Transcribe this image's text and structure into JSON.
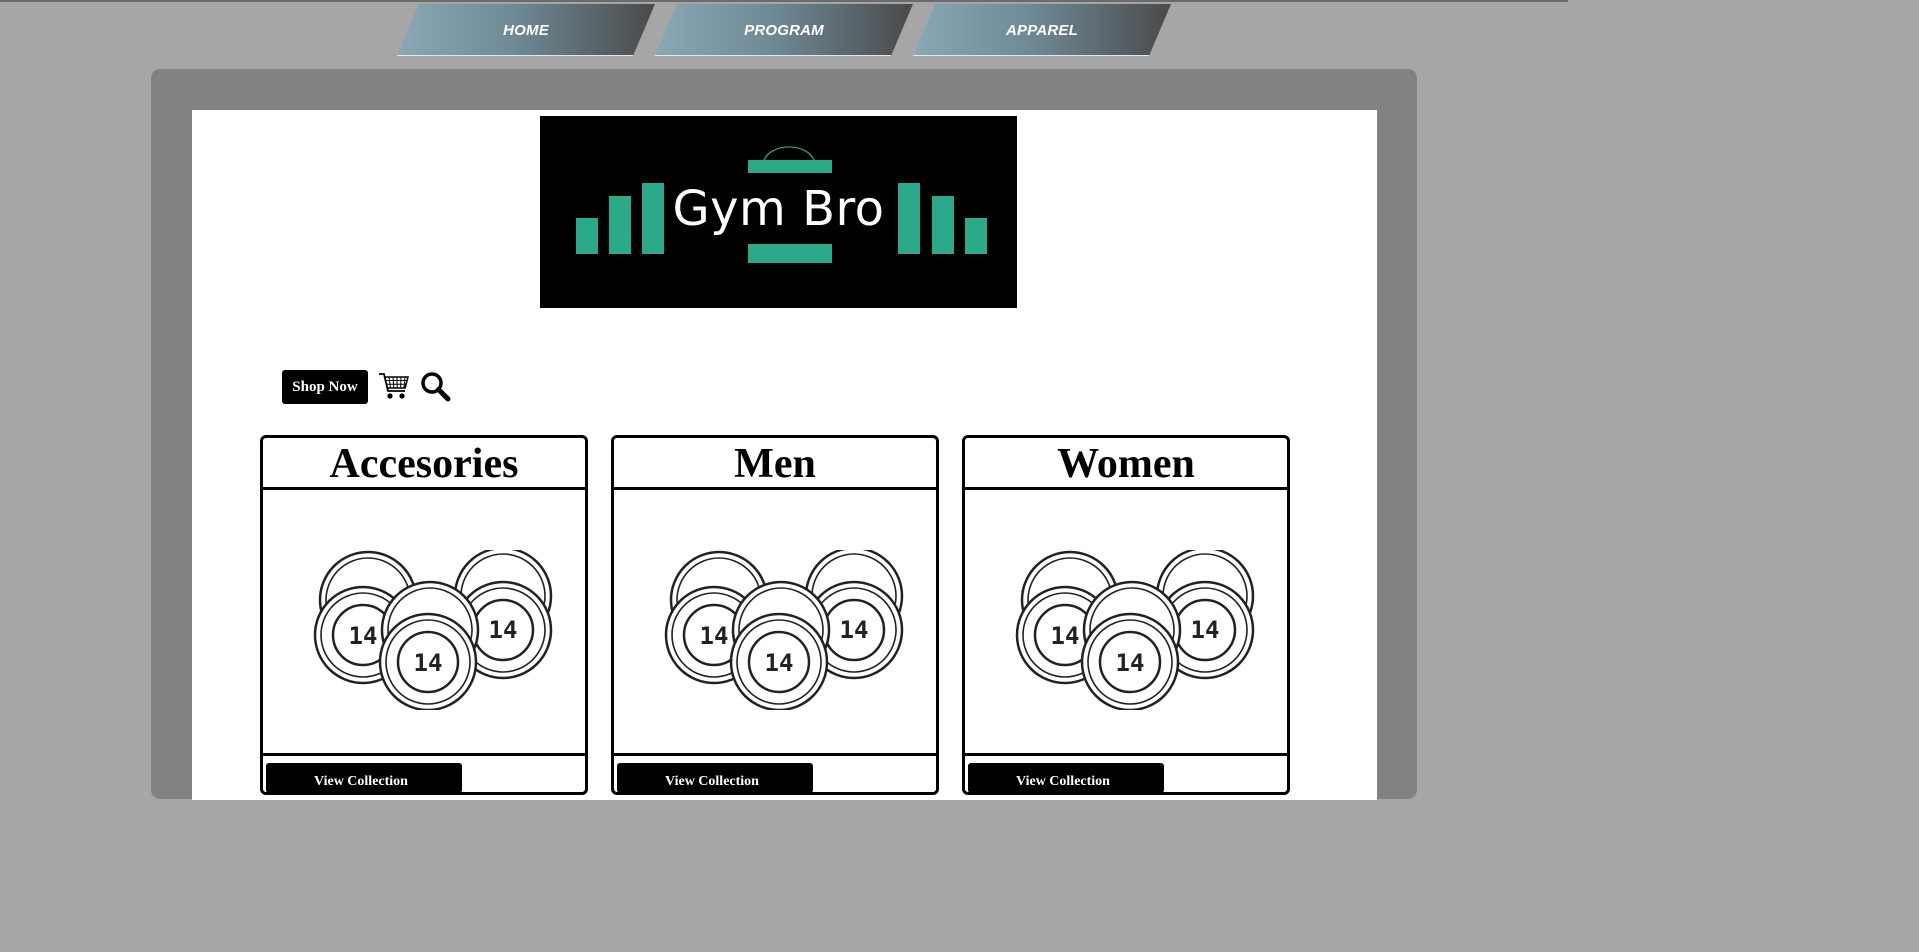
{
  "nav": {
    "items": [
      {
        "label": "HOME"
      },
      {
        "label": "PROGRAM"
      },
      {
        "label": "APPAREL"
      }
    ]
  },
  "logo": {
    "text": "Gym Bro",
    "accent_color": "#2baa8a"
  },
  "toolbar": {
    "shop_label": "Shop Now",
    "cart_icon": "cart-icon",
    "search_icon": "search-icon"
  },
  "cards": [
    {
      "title": "Accesories",
      "plate_label": "14",
      "button_label": "View Collection"
    },
    {
      "title": "Men",
      "plate_label": "14",
      "button_label": "View Collection"
    },
    {
      "title": "Women",
      "plate_label": "14",
      "button_label": "View Collection"
    }
  ]
}
